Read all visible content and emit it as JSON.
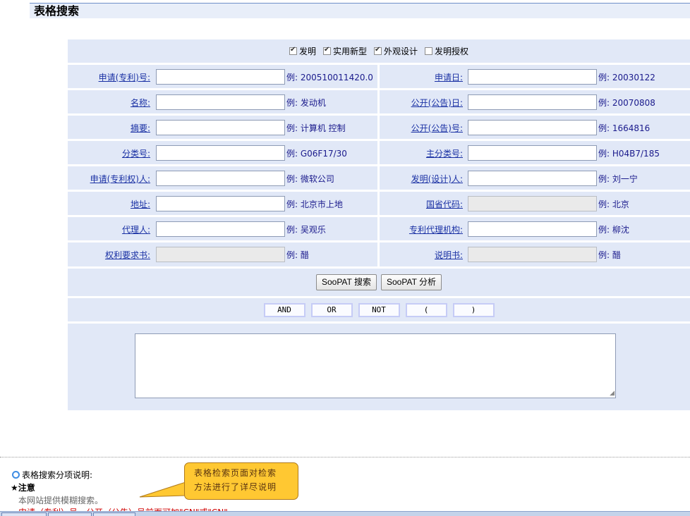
{
  "page": {
    "title": "表格搜索"
  },
  "patent_types": [
    {
      "label": "发明",
      "checked": true
    },
    {
      "label": "实用新型",
      "checked": true
    },
    {
      "label": "外观设计",
      "checked": true
    },
    {
      "label": "发明授权",
      "checked": false
    }
  ],
  "fields": [
    {
      "left": {
        "label": "申请(专利)号:",
        "example": "例: 200510011420.0",
        "disabled": false
      },
      "right": {
        "label": "申请日:",
        "example": "例: 20030122",
        "disabled": false
      }
    },
    {
      "left": {
        "label": "名称:",
        "example": "例: 发动机",
        "disabled": false
      },
      "right": {
        "label": "公开(公告)日:",
        "example": "例: 20070808",
        "disabled": false
      }
    },
    {
      "left": {
        "label": "摘要:",
        "example": "例: 计算机 控制",
        "disabled": false
      },
      "right": {
        "label": "公开(公告)号:",
        "example": "例: 1664816",
        "disabled": false
      }
    },
    {
      "left": {
        "label": "分类号:",
        "example": "例: G06F17/30",
        "disabled": false
      },
      "right": {
        "label": "主分类号:",
        "example": "例: H04B7/185",
        "disabled": false
      }
    },
    {
      "left": {
        "label": "申请(专利权)人:",
        "example": "例: 微软公司",
        "disabled": false
      },
      "right": {
        "label": "发明(设计)人:",
        "example": "例: 刘一宁",
        "disabled": false
      }
    },
    {
      "left": {
        "label": "地址:",
        "example": "例: 北京市上地",
        "disabled": false
      },
      "right": {
        "label": "国省代码:",
        "example": "例: 北京",
        "disabled": true
      }
    },
    {
      "left": {
        "label": "代理人:",
        "example": "例: 吴观乐",
        "disabled": false
      },
      "right": {
        "label": "专利代理机构:",
        "example": "例: 柳沈",
        "disabled": false
      }
    },
    {
      "left": {
        "label": "权利要求书:",
        "example": "例: 醋",
        "disabled": true
      },
      "right": {
        "label": "说明书:",
        "example": "例: 醋",
        "disabled": true
      }
    }
  ],
  "buttons": {
    "search": "SooPAT 搜索",
    "analyze": "SooPAT 分析"
  },
  "operators": [
    "AND",
    "OR",
    "NOT",
    "(",
    ")"
  ],
  "notes": {
    "heading": "表格搜索分项说明:",
    "attention": "注意",
    "fuzzy": "本网站提供模糊搜索。",
    "partial": "申请（专利）号、公开（公告）号前面可加\"CN\"或\"CN\""
  },
  "callout": {
    "line1": "表格检索页面对检索",
    "line2": "方法进行了详尽说明"
  },
  "colors": {
    "panel": "#e1e8f7",
    "label_link": "#1a31a4",
    "callout": "#ffc832"
  }
}
